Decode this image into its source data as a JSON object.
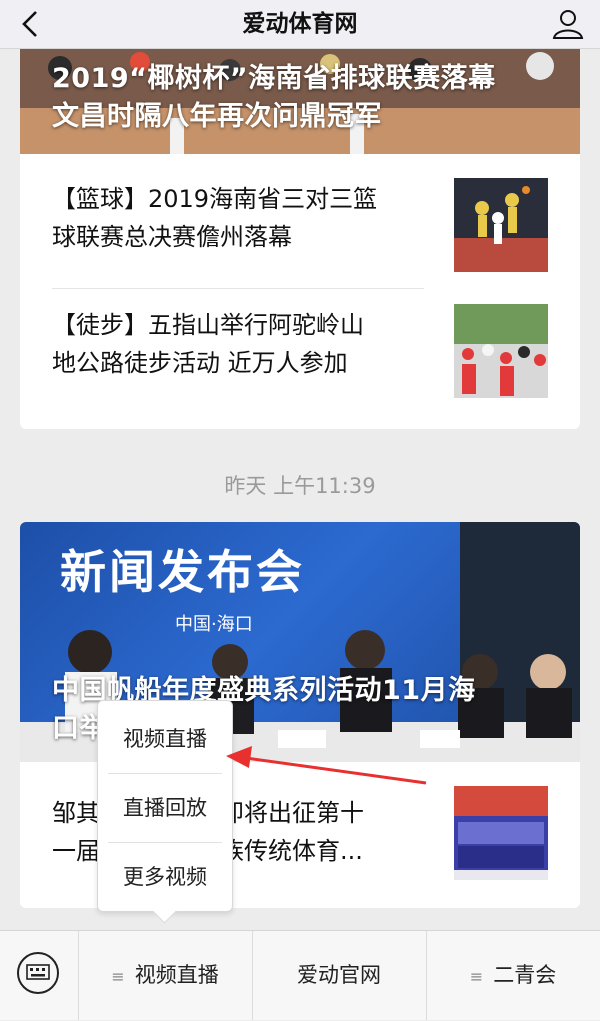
{
  "header": {
    "title": "爱动体育网"
  },
  "card1": {
    "hero_title_line1": "2019“椰树杯”海南省排球联赛落幕",
    "hero_title_line2": "文昌时隔八年再次问鼎冠军",
    "items": [
      {
        "line1": "【篮球】2019海南省三对三篮",
        "line2": "球联赛总决赛儋州落幕"
      },
      {
        "line1": "【徒步】五指山举行阿驼岭山",
        "line2": "地公路徒步活动 近万人参加"
      }
    ]
  },
  "timestamp": "昨天 上午11:39",
  "card2": {
    "banner_title": "新闻发布会",
    "banner_sub": "中国·海口",
    "hero_title_line1": "中国帆船年度盛典系列活动11月海",
    "hero_title_line2": "口举",
    "item": {
      "line1": "邹其",
      "line1b": "即将出征第十",
      "line2": "一届",
      "line2b": "族传统体育..."
    }
  },
  "popup": {
    "items": [
      "视频直播",
      "直播回放",
      "更多视频"
    ]
  },
  "bottombar": {
    "menus": [
      "视频直播",
      "爱动官网",
      "二青会"
    ]
  },
  "colors": {
    "arrow": "#e8302f",
    "timestamp": "#9a9a9a"
  }
}
